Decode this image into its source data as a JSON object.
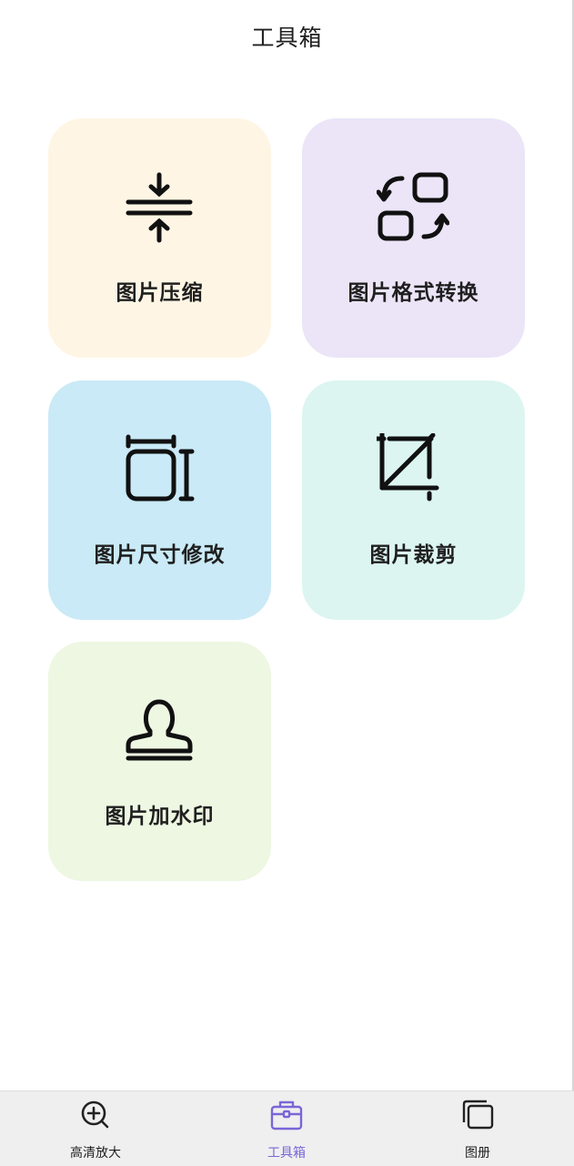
{
  "header": {
    "title": "工具箱"
  },
  "tools": [
    {
      "label": "图片压缩",
      "icon": "compress-icon"
    },
    {
      "label": "图片格式转换",
      "icon": "format-convert-icon"
    },
    {
      "label": "图片尺寸修改",
      "icon": "resize-icon"
    },
    {
      "label": "图片裁剪",
      "icon": "crop-icon"
    },
    {
      "label": "图片加水印",
      "icon": "stamp-icon"
    }
  ],
  "tabbar": {
    "items": [
      {
        "label": "高清放大",
        "icon": "zoom-in-icon",
        "active": false
      },
      {
        "label": "工具箱",
        "icon": "toolbox-icon",
        "active": true
      },
      {
        "label": "图册",
        "icon": "album-icon",
        "active": false
      }
    ]
  },
  "colors": {
    "accent": "#7a66d8",
    "card_compress": "#fff5e4",
    "card_convert": "#ebe5f7",
    "card_resize": "#c9eaf6",
    "card_crop": "#dcf5f1",
    "card_watermark": "#edf7e2",
    "tabbar_bg": "#efefef"
  }
}
